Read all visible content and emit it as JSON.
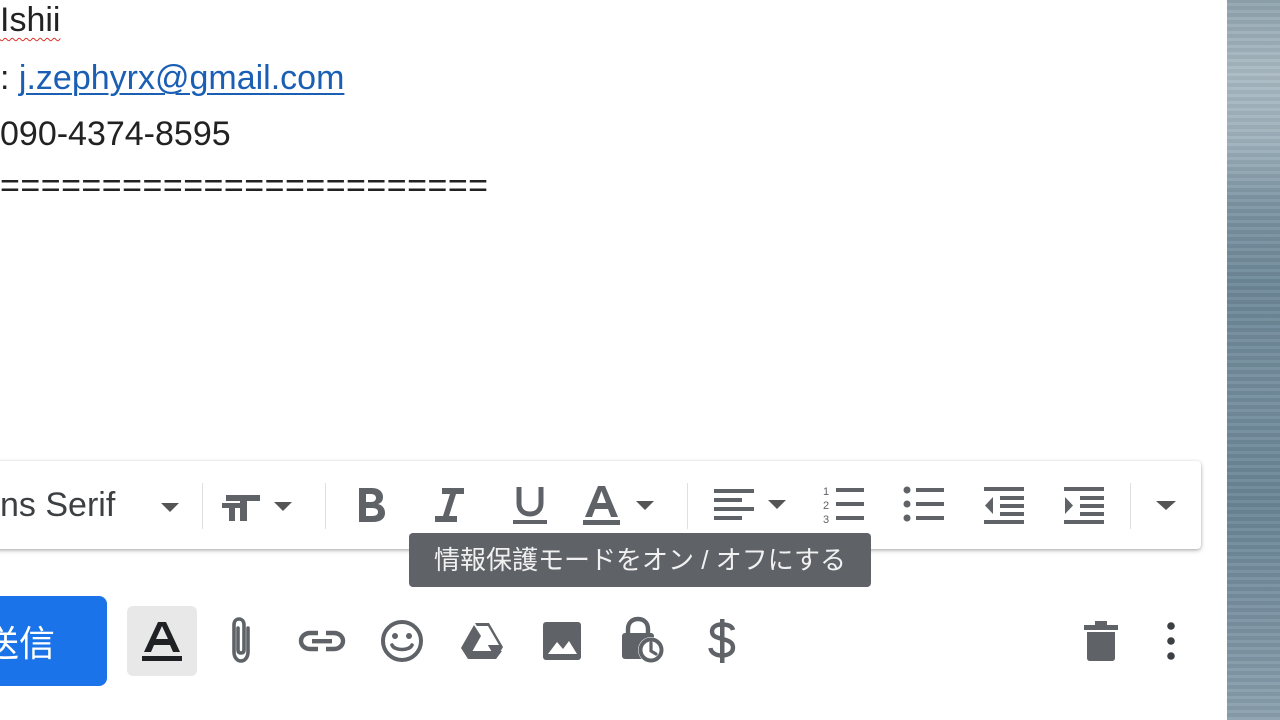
{
  "body": {
    "name_line": "Ishii",
    "email_prefix": ": ",
    "email": "j.zephyrx@gmail.com",
    "phone": "090-4374-8595",
    "separator": "========================"
  },
  "format_toolbar": {
    "font_label": "ns Serif",
    "icons": [
      "text-size-icon",
      "bold-icon",
      "italic-icon",
      "underline-icon",
      "text-color-icon",
      "align-icon",
      "numbered-list-icon",
      "bulleted-list-icon",
      "indent-less-icon",
      "indent-more-icon",
      "more-formatting-icon"
    ]
  },
  "tooltip": {
    "text": "情報保護モードをオン / オフにする"
  },
  "action_bar": {
    "send_label": "送信",
    "icons": [
      "formatting-options-icon",
      "attach-icon",
      "link-icon",
      "emoji-icon",
      "drive-icon",
      "photo-icon",
      "confidential-mode-icon",
      "money-icon",
      "discard-icon",
      "more-options-icon"
    ]
  },
  "colors": {
    "send_button": "#1a73e8",
    "link": "#1a5fb4",
    "tooltip_bg": "#5f6368",
    "icon": "#5f6368"
  }
}
